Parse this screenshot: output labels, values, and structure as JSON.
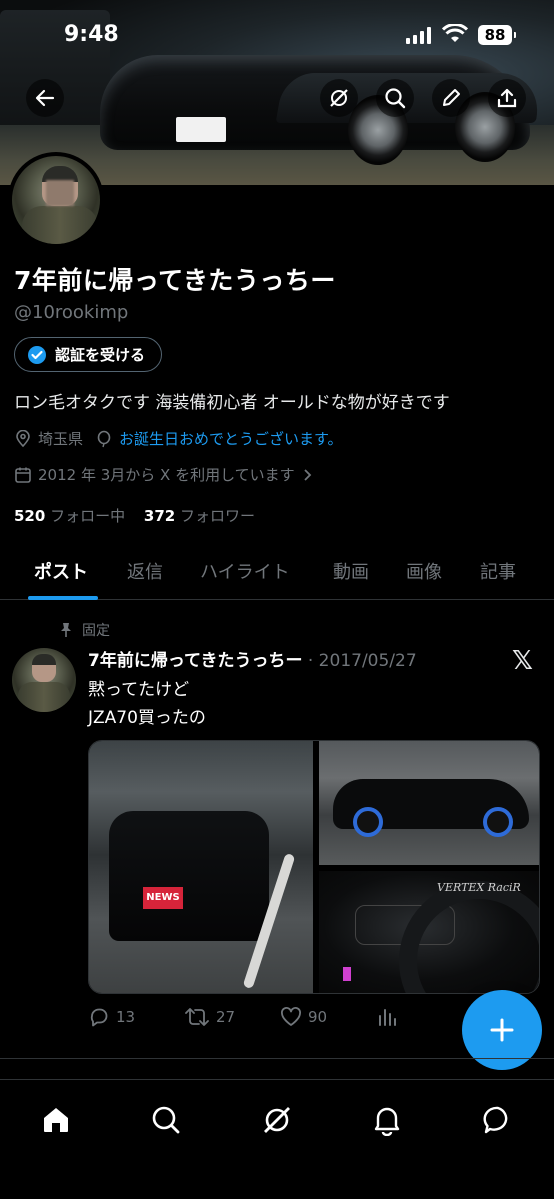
{
  "status_bar": {
    "time": "9:48",
    "battery": "88"
  },
  "profile": {
    "name": "7年前に帰ってきたうっちー",
    "handle": "@10rookimp",
    "verify_label": "認証を受ける",
    "bio": "ロン毛オタクです 海装備初心者 オールドな物が好きです",
    "location": "埼玉県",
    "birthday": "お誕生日おめでとうございます。",
    "joined": "2012 年 3月から X を利用しています",
    "following_count": "520",
    "following_label": "フォロー中",
    "followers_count": "372",
    "followers_label": "フォロワー"
  },
  "tabs": [
    "ポスト",
    "返信",
    "ハイライト",
    "動画",
    "画像",
    "記事"
  ],
  "pinned_post": {
    "pinned_label": "固定",
    "author": "7年前に帰ってきたうっちー",
    "date": "· 2017/05/27",
    "text_line1": "黙ってたけど",
    "text_line2": "JZA70買ったの",
    "media_sticker": "NEWS",
    "media_brand": "VERTEX RaciR",
    "replies": "13",
    "reposts": "27",
    "likes": "90"
  },
  "colors": {
    "accent": "#1d9bf0",
    "background": "#000000",
    "muted": "#71767b"
  }
}
